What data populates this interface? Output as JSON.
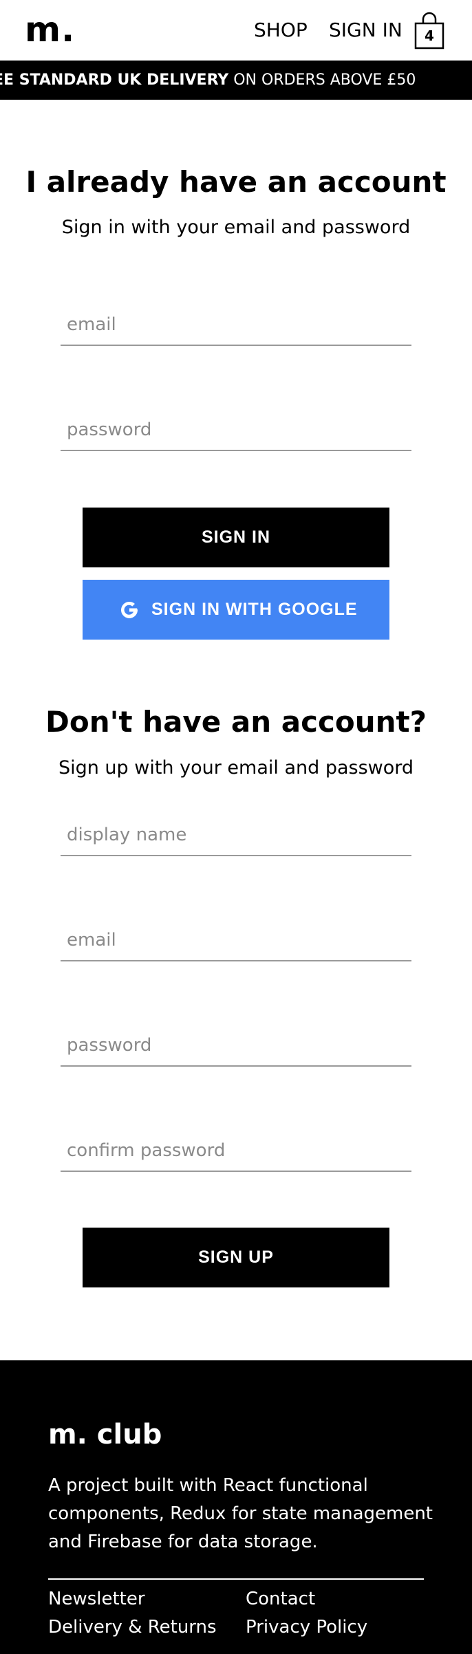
{
  "header": {
    "logo": "m.",
    "nav": {
      "shop": "SHOP",
      "sign_in": "SIGN IN"
    },
    "cart": {
      "icon": "shopping-bag-icon",
      "count": "4"
    }
  },
  "banner": {
    "strong": "EE STANDARD UK DELIVERY",
    "rest": " ON ORDERS ABOVE £50"
  },
  "sign_in": {
    "title": "I already have an account",
    "subtitle": "Sign in with your email and password",
    "email_placeholder": "email",
    "password_placeholder": "password",
    "submit_label": "SIGN IN",
    "google_label": "SIGN IN WITH GOOGLE",
    "google_icon": "google-g-icon"
  },
  "sign_up": {
    "title": "Don't have an account?",
    "subtitle": "Sign up with your email and password",
    "display_name_placeholder": "display name",
    "email_placeholder": "email",
    "password_placeholder": "password",
    "confirm_password_placeholder": "confirm password",
    "submit_label": "SIGN UP"
  },
  "footer": {
    "title": "m. club",
    "description": "A project built with React functional components, Redux for state management and Firebase for data storage.",
    "links": {
      "newsletter": "Newsletter",
      "contact": "Contact",
      "delivery": "Delivery & Returns",
      "privacy": "Privacy Policy"
    }
  },
  "colors": {
    "primary": "#000000",
    "google_blue": "#4285f4",
    "field_underline": "#9a9a9a",
    "placeholder": "#8a8a8a"
  }
}
